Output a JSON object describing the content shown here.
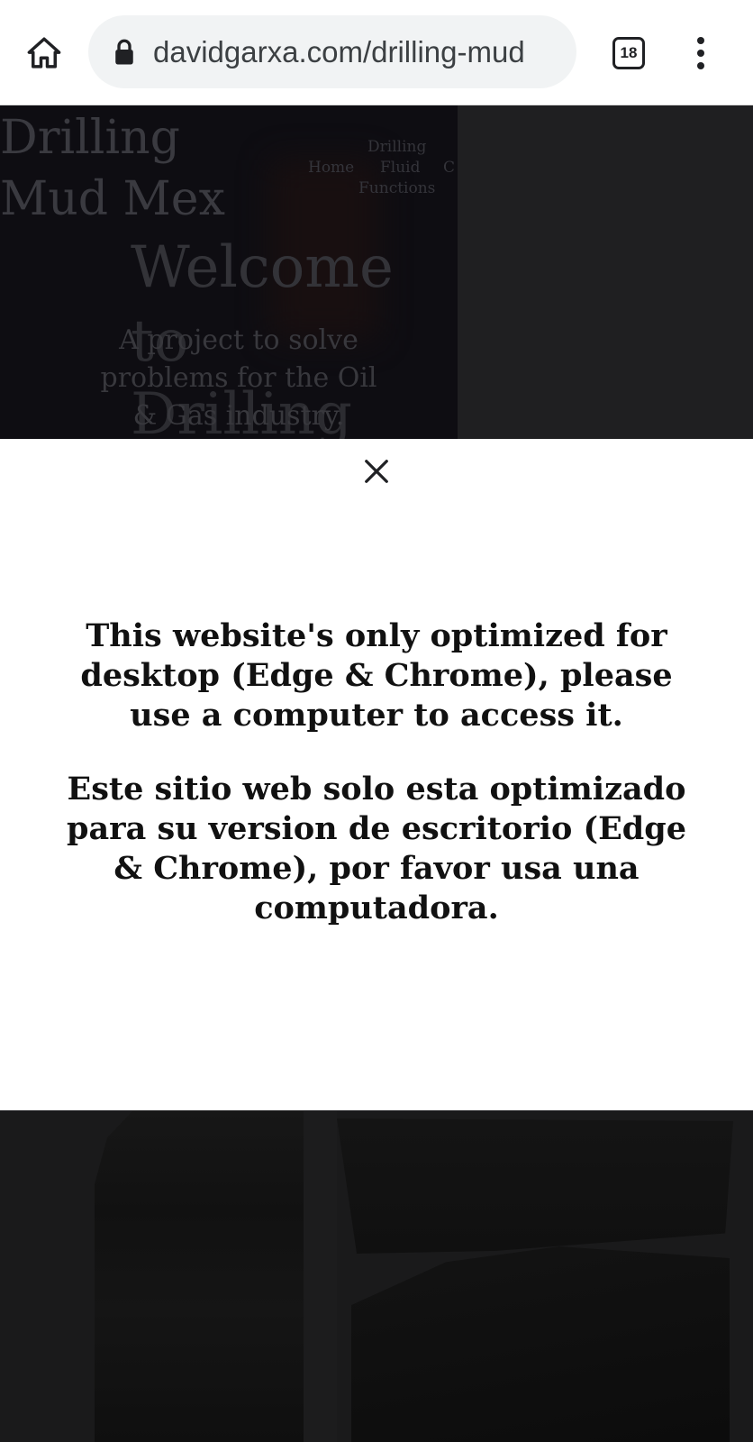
{
  "browser": {
    "url": "davidgarxa.com/drilling-mud",
    "tab_count": "18",
    "icons": {
      "home": "home-icon",
      "lock": "lock-icon",
      "tabs": "tab-switcher-icon",
      "menu": "more-vert-icon"
    }
  },
  "site": {
    "title": "Drilling Mud Mex",
    "nav": [
      "Drilling",
      "Home",
      "Fluid",
      "C",
      "Functions"
    ],
    "hero_heading": "Welcome",
    "hero_heading_2": "to",
    "hero_heading_3": "Drilling",
    "tagline": "A project to solve problems for the Oil & Gas industry."
  },
  "modal": {
    "close_icon": "close-icon",
    "message_en": "This website's only optimized for desktop (Edge & Chrome), please use a computer to access it.",
    "message_es": "Este sitio web solo esta optimizado para su version de escritorio (Edge & Chrome), por favor usa una computadora."
  },
  "colors": {
    "chrome_bg": "#ffffff",
    "omnibox_bg": "#f1f3f4",
    "overlay_dark": "#1d1d1f",
    "modal_bg": "#ffffff",
    "modal_text": "#111111"
  }
}
